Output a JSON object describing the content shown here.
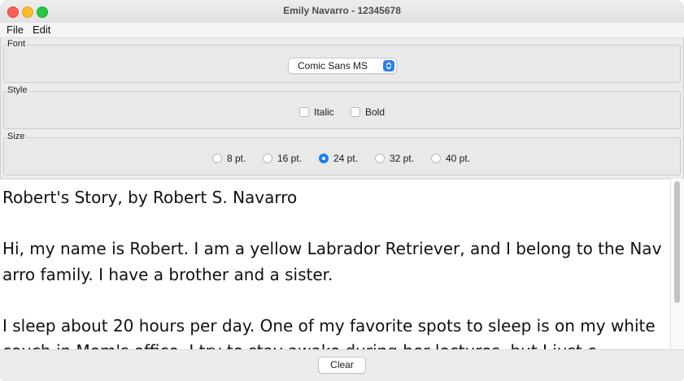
{
  "window": {
    "title": "Emily Navarro - 12345678"
  },
  "menu": {
    "file": "File",
    "edit": "Edit"
  },
  "font_group": {
    "label": "Font",
    "selected": "Comic Sans MS"
  },
  "style_group": {
    "label": "Style",
    "italic_label": "Italic",
    "italic_checked": false,
    "bold_label": "Bold",
    "bold_checked": false
  },
  "size_group": {
    "label": "Size",
    "options": [
      {
        "label": "8 pt.",
        "selected": false
      },
      {
        "label": "16 pt.",
        "selected": false
      },
      {
        "label": "24 pt.",
        "selected": true
      },
      {
        "label": "32 pt.",
        "selected": false
      },
      {
        "label": "40 pt.",
        "selected": false
      }
    ]
  },
  "text_area": {
    "content": "Robert's Story, by Robert S. Navarro\n\nHi, my name is Robert. I am a yellow Labrador Retriever, and I belong to the Navarro family. I have a brother and a sister.\n\nI sleep about 20 hours per day. One of my favorite spots to sleep is on my white couch in Mom's office. I try to stay awake during her lectures, but I just c"
  },
  "buttons": {
    "clear": "Clear"
  },
  "colors": {
    "accent": "#1a7ff0",
    "close": "#fe5f57",
    "minimize": "#febc2e",
    "maximize": "#28c840"
  }
}
